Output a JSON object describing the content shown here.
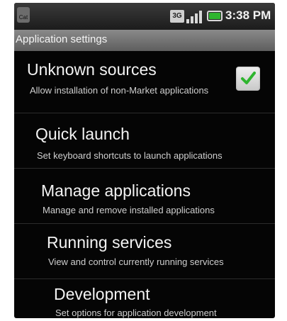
{
  "status_bar": {
    "network_type": "3G",
    "time": "3:38 PM",
    "notification_icon": "cat-notification-icon",
    "battery_color": "#2fb52f"
  },
  "header": {
    "title": "Application settings"
  },
  "settings": [
    {
      "title": "Unknown sources",
      "summary": "Allow installation of non-Market applications",
      "checked": true
    },
    {
      "title": "Quick launch",
      "summary": "Set keyboard shortcuts to launch applications"
    },
    {
      "title": "Manage applications",
      "summary": "Manage and remove installed applications"
    },
    {
      "title": "Running services",
      "summary": "View and control currently running services"
    },
    {
      "title": "Development",
      "summary": "Set options for application development"
    }
  ]
}
